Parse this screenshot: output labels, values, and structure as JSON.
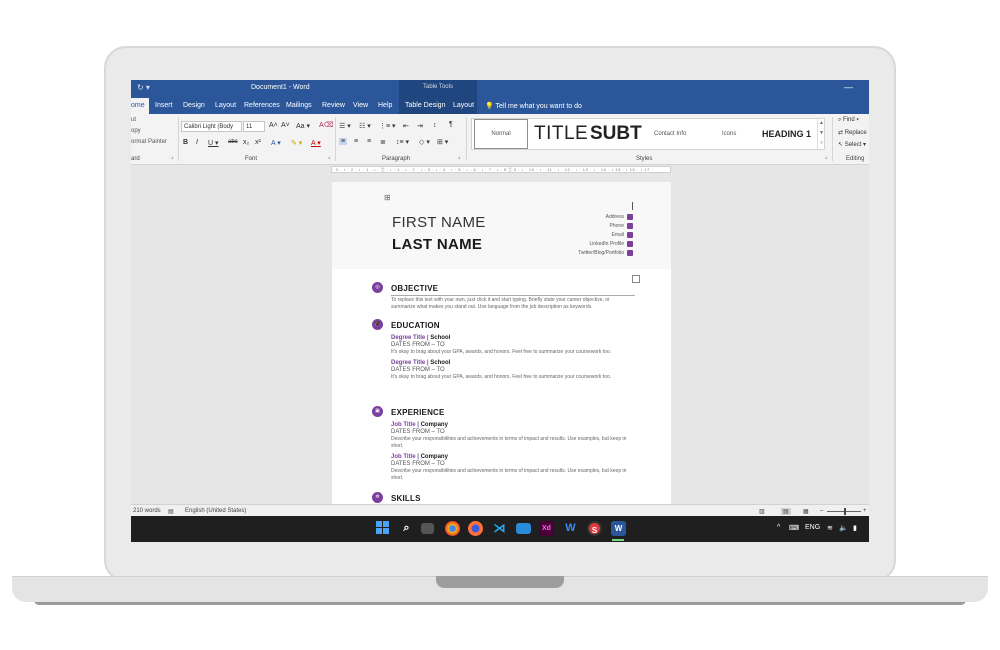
{
  "titlebar": {
    "doc_title": "Document1  -  Word",
    "contextual": "Table Tools",
    "quick_access": "↻  ▾",
    "minimize": "—"
  },
  "tabs": [
    "ome",
    "Insert",
    "Design",
    "Layout",
    "References",
    "Mailings",
    "Review",
    "View",
    "Help",
    "Table Design",
    "Layout"
  ],
  "tell_me": "Tell me what you want to do",
  "ribbon": {
    "clipboard": {
      "items": [
        "ut",
        "opy",
        "ormat Painter"
      ],
      "label": "ard"
    },
    "font": {
      "face": "Calibri Light (Body",
      "size": "11",
      "label": "Font"
    },
    "paragraph": {
      "label": "Paragraph"
    },
    "styles": {
      "label": "Styles",
      "items": [
        "Normal",
        "TITLE",
        "SUBT",
        "Contact Info",
        "Icons",
        "HEADING 1"
      ]
    },
    "editing": {
      "items": [
        "Find",
        "Replace",
        "Select"
      ],
      "label": "Editing"
    }
  },
  "ruler": "· 3 · ı · 2 · ı · 1 · ı · ▒ · ı · 1 · ı · 2 · ı · 3 · ı · 4 · ı · 5 · ı · 6 · ı · 7 · ı · 8 ▒ 9 · ı · 10 · ı · 11 · ı · 12 · ı · 13 · ı · 14 · ı 15 · ı 16 · ı 17 ·",
  "resume": {
    "first_name": "FIRST NAME",
    "last_name": "LAST NAME",
    "contact": [
      "Address",
      "Phone",
      "Email",
      "LinkedIn Profile",
      "Twitter/Blog/Portfolio"
    ],
    "objective": {
      "title": "OBJECTIVE",
      "text": "To replace this text with your own, just click it and start typing. Briefly state your career objective, or summarize what makes you stand out. Use language from the job description as keywords."
    },
    "education": {
      "title": "EDUCATION",
      "entries": [
        {
          "degree": "Degree Title",
          "sep": "|",
          "school": "School",
          "dates": "DATES FROM – TO",
          "text": "It's okay to brag about your GPA, awards, and honors. Feel free to summarize your coursework too."
        },
        {
          "degree": "Degree Title",
          "sep": "|",
          "school": "School",
          "dates": "DATES FROM – TO",
          "text": "It's okay to brag about your GPA, awards, and honors. Feel free to summarize your coursework too."
        }
      ]
    },
    "experience": {
      "title": "EXPERIENCE",
      "entries": [
        {
          "job": "Job Title",
          "sep": "|",
          "company": "Company",
          "dates": "DATES FROM – TO",
          "text": "Describe your responsibilities and achievements in terms of impact and results. Use examples, but keep in short."
        },
        {
          "job": "Job Title",
          "sep": "|",
          "company": "Company",
          "dates": "DATES FROM – TO",
          "text": "Describe your responsibilities and achievements in terms of impact and results. Use examples, but keep in short."
        }
      ]
    },
    "skills": {
      "title": "SKILLS"
    }
  },
  "status": {
    "words": "210 words",
    "language": "English (United States)"
  },
  "taskbar": {
    "lang": "ENG",
    "apps": [
      "search-icon",
      "task-view-icon",
      "chrome-icon",
      "firefox-icon",
      "vscode-icon",
      "display-icon",
      "xd-icon",
      "wps-icon",
      "s-app-icon",
      "word-icon"
    ],
    "xd": "Xd",
    "s": "S",
    "w": "W"
  },
  "colors": {
    "word_blue": "#2b579a",
    "accent_purple": "#7b3f9e",
    "taskbar": "#1f1f1f"
  }
}
